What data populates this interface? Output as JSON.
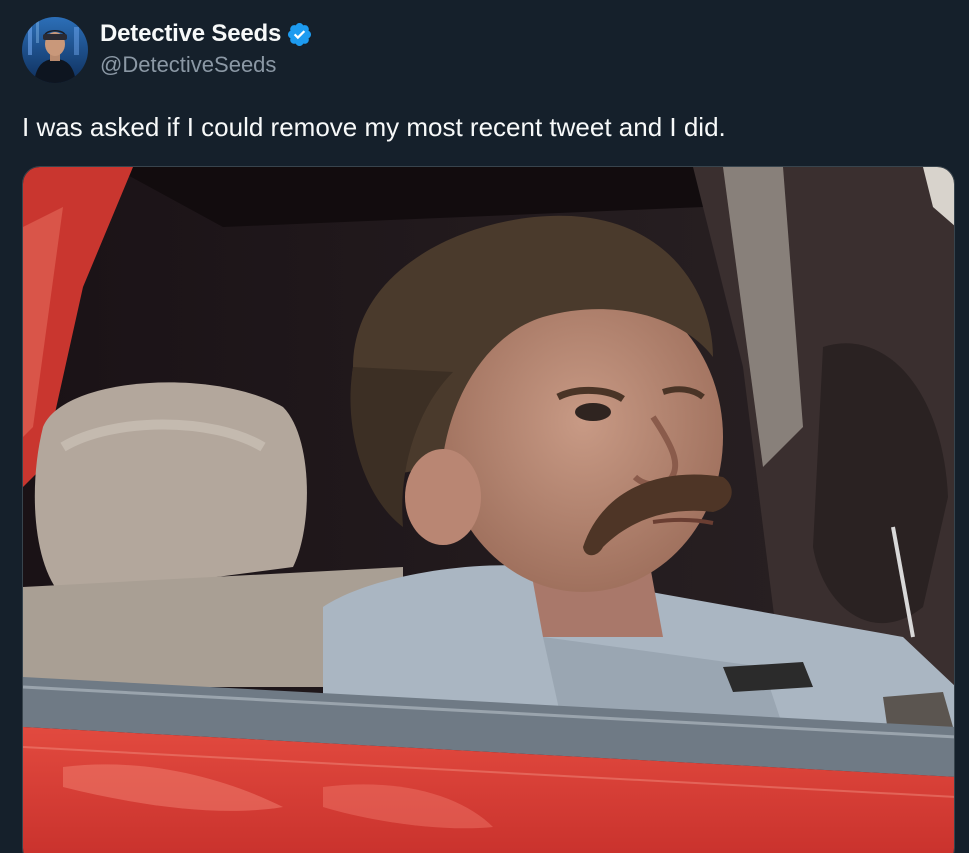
{
  "author": {
    "display_name": "Detective Seeds",
    "handle": "@DetectiveSeeds",
    "verified": true,
    "verified_color": "#1d9bf0",
    "avatar_icon": "profile-avatar"
  },
  "tweet": {
    "text": "I was asked if I could remove my most recent tweet and I did."
  },
  "media": {
    "type": "image",
    "subject": "man with mustache in red car",
    "colors": {
      "car_red": "#d83a33",
      "shirt": "#aab6c2",
      "hair": "#4a3a2c",
      "skin": "#b0806a"
    }
  },
  "theme": {
    "background": "#15202b",
    "text_primary": "#f7f9f9",
    "text_secondary": "#8b98a5",
    "border": "#38444d"
  }
}
